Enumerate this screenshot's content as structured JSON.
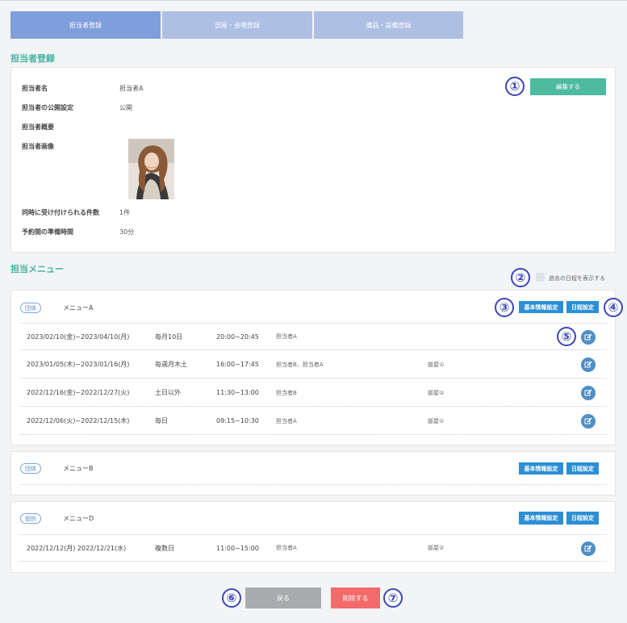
{
  "tabs": [
    {
      "label": "担当者登録"
    },
    {
      "label": "部屋・会場登録"
    },
    {
      "label": "備品・設備登録"
    }
  ],
  "staff_section": {
    "title": "担当者登録",
    "edit_button": "編集する",
    "fields": [
      {
        "label": "担当者名",
        "value": "担当者A"
      },
      {
        "label": "担当者の公開設定",
        "value": "公開"
      },
      {
        "label": "担当者概要",
        "value": ""
      },
      {
        "label": "担当者画像",
        "value": ""
      },
      {
        "label": "同時に受け付けられる件数",
        "value": "1件"
      },
      {
        "label": "予約間の準備時間",
        "value": "30分"
      }
    ]
  },
  "menu_section": {
    "title": "担当メニュー",
    "show_past_label": "過去の日程を表示する",
    "basic_settings_label": "基本情報設定",
    "schedule_settings_label": "日程設定",
    "menus": [
      {
        "tag": "団体",
        "name": "メニューA",
        "rows": [
          {
            "period": "2023/02/10(金)~2023/04/10(月)",
            "repeat": "毎月10日",
            "time": "20:00~20:45",
            "staff": "担当者A",
            "room": ""
          },
          {
            "period": "2023/01/05(木)~2023/01/16(月)",
            "repeat": "毎週月木土",
            "time": "16:00~17:45",
            "staff": "担当者B、担当者A",
            "room": "部屋①"
          },
          {
            "period": "2022/12/16(金)~2022/12/27(火)",
            "repeat": "土日以外",
            "time": "11:30~13:00",
            "staff": "担当者B",
            "room": "部屋②"
          },
          {
            "period": "2022/12/06(火)~2022/12/15(木)",
            "repeat": "毎日",
            "time": "09:15~10:30",
            "staff": "担当者A",
            "room": "部屋①"
          }
        ]
      },
      {
        "tag": "団体",
        "name": "メニューB",
        "rows": []
      },
      {
        "tag": "個別",
        "name": "メニューD",
        "rows": [
          {
            "period": "2022/12/12(月) 2022/12/21(水)",
            "repeat": "複数日",
            "time": "11:00~15:00",
            "staff": "担当者A",
            "room": "部屋②"
          }
        ]
      }
    ]
  },
  "footer": {
    "back_label": "戻る",
    "delete_label": "削除する"
  },
  "callouts": [
    "①",
    "②",
    "③",
    "④",
    "⑤",
    "⑥",
    "⑦"
  ],
  "colors": {
    "tab_active": "#7f9fdc",
    "tab_inactive": "#aebfe4",
    "section_title": "#3fb39d",
    "green_button": "#4dbb9e",
    "blue_button": "#2c8fd6",
    "edit_icon_bg": "#4f8fc6",
    "back_button": "#a9acad",
    "delete_button": "#f36a6a",
    "callout": "#3b46b8"
  }
}
